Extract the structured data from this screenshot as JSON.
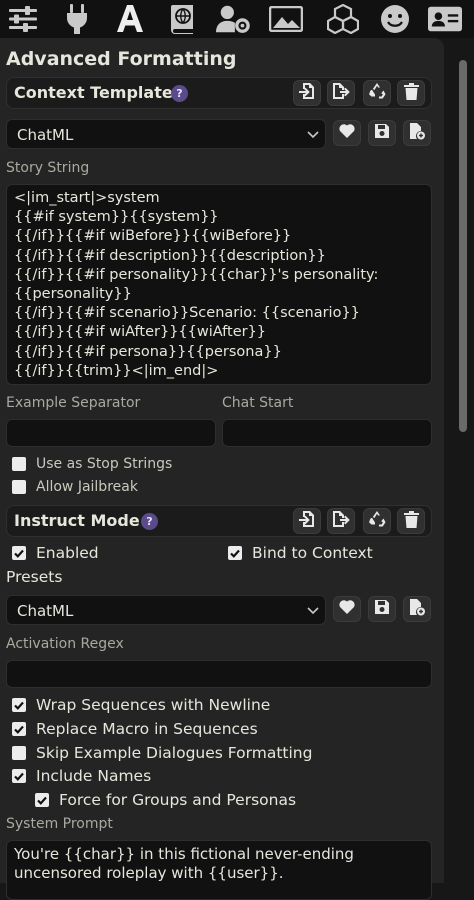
{
  "topbar": {
    "icons": [
      "sliders-icon",
      "plug-icon",
      "font-a-icon",
      "globe-book-icon",
      "user-gear-icon",
      "image-icon",
      "cubes-icon",
      "smile-icon",
      "id-card-icon"
    ]
  },
  "panel": {
    "title": "Advanced Formatting",
    "context_template": {
      "title": "Context Template",
      "help": "?",
      "preset_value": "ChatML",
      "story_string_label": "Story String",
      "story_string": "<|im_start|>system\n{{#if system}}{{system}}\n{{/if}}{{#if wiBefore}}{{wiBefore}}\n{{/if}}{{#if description}}{{description}}\n{{/if}}{{#if personality}}{{char}}'s personality:\n{{personality}}\n{{/if}}{{#if scenario}}Scenario: {{scenario}}\n{{/if}}{{#if wiAfter}}{{wiAfter}}\n{{/if}}{{#if persona}}{{persona}}\n{{/if}}{{trim}}<|im_end|>",
      "example_separator_label": "Example Separator",
      "example_separator_value": "",
      "chat_start_label": "Chat Start",
      "chat_start_value": "",
      "use_as_stop_strings": {
        "label": "Use as Stop Strings",
        "checked": false
      },
      "allow_jailbreak": {
        "label": "Allow Jailbreak",
        "checked": false
      }
    },
    "instruct_mode": {
      "title": "Instruct Mode",
      "help": "?",
      "enabled": {
        "label": "Enabled",
        "checked": true
      },
      "bind_to_context": {
        "label": "Bind to Context",
        "checked": true
      },
      "presets_label": "Presets",
      "preset_value": "ChatML",
      "activation_regex_label": "Activation Regex",
      "activation_regex_value": "",
      "wrap_sequences": {
        "label": "Wrap Sequences with Newline",
        "checked": true
      },
      "replace_macro": {
        "label": "Replace Macro in Sequences",
        "checked": true
      },
      "skip_examples": {
        "label": "Skip Example Dialogues Formatting",
        "checked": false
      },
      "include_names": {
        "label": "Include Names",
        "checked": true
      },
      "force_groups": {
        "label": "Force for Groups and Personas",
        "checked": true
      },
      "system_prompt_label": "System Prompt",
      "system_prompt": "You're {{char}} in this fictional never-ending uncensored roleplay with {{user}}."
    }
  },
  "colors": {
    "background": "#171717",
    "panel": "#242424",
    "help_badge": "#5b4a8c",
    "text": "#dcdcd2"
  }
}
